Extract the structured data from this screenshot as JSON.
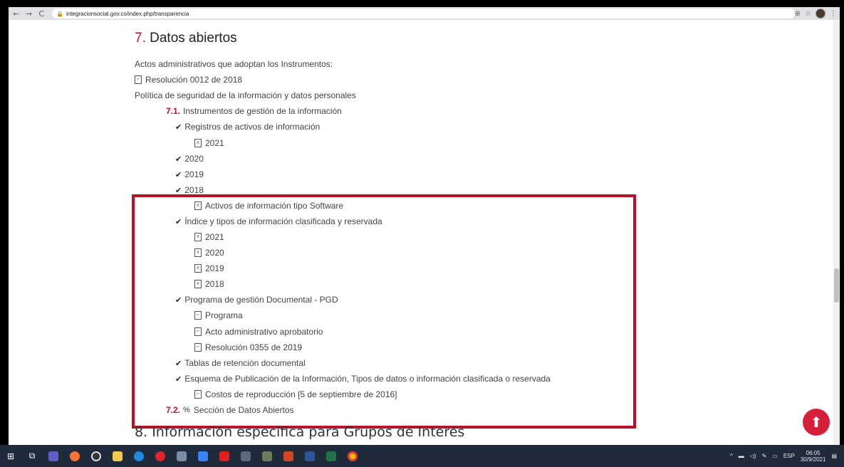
{
  "browser": {
    "url": "integracionsocial.gov.co/index.php/transparencia",
    "icons": [
      "back-arrow-icon",
      "forward-arrow-icon",
      "reload-icon",
      "lock-icon",
      "zoom-icon",
      "star-icon",
      "profile-icon",
      "menu-icon"
    ]
  },
  "page": {
    "section": {
      "number": "7.",
      "title": "Datos abiertos"
    },
    "items": [
      {
        "type": "text",
        "label": "Actos administrativos que adoptan los Instrumentos:"
      },
      {
        "type": "pdf",
        "label": "Resolución 0012 de 2018"
      },
      {
        "type": "text",
        "label": "Política de seguridad de la información y datos personales"
      },
      {
        "type": "subsection",
        "number": "7.1.",
        "label": "Instrumentos de gestión de la información"
      },
      {
        "type": "check",
        "label": "Registros de activos de información"
      },
      {
        "type": "xls",
        "label": "2021"
      },
      {
        "type": "check",
        "label": "2020"
      },
      {
        "type": "check",
        "label": "2019"
      },
      {
        "type": "check",
        "label": "2018"
      },
      {
        "type": "xls",
        "label": "Activos de información tipo Software"
      },
      {
        "type": "check",
        "label": "Índice y tipos de información clasificada y reservada"
      },
      {
        "type": "xls",
        "label": "2021"
      },
      {
        "type": "xls",
        "label": "2020"
      },
      {
        "type": "xls",
        "label": "2019"
      },
      {
        "type": "xls",
        "label": "2018"
      },
      {
        "type": "check",
        "label": "Programa de gestión Documental - PGD"
      },
      {
        "type": "pdf",
        "label": "Programa"
      },
      {
        "type": "pdf",
        "label": "Acto administrativo aprobatorio"
      },
      {
        "type": "pdf",
        "label": "Resolución 0355 de 2019"
      },
      {
        "type": "check",
        "label": "Tablas de retención documental"
      },
      {
        "type": "check",
        "label": "Esquema de Publicación de la Información, Tipos de datos o información clasificada o reservada"
      },
      {
        "type": "pdf",
        "label": "Costos de reproducción [5 de septiembre de 2016]"
      },
      {
        "type": "subsection-link",
        "number": "7.2.",
        "label": "Sección de Datos Abiertos"
      }
    ],
    "next_section": {
      "number": "8.",
      "title": "Información específica para Grupos de Interés"
    }
  },
  "colors": {
    "accent": "#c8102e",
    "highlight_box": "#b7142a",
    "fab": "#d61f38"
  },
  "taskbar": {
    "tray_lang": "ESP",
    "time": "06:05",
    "date": "30/9/2021"
  }
}
